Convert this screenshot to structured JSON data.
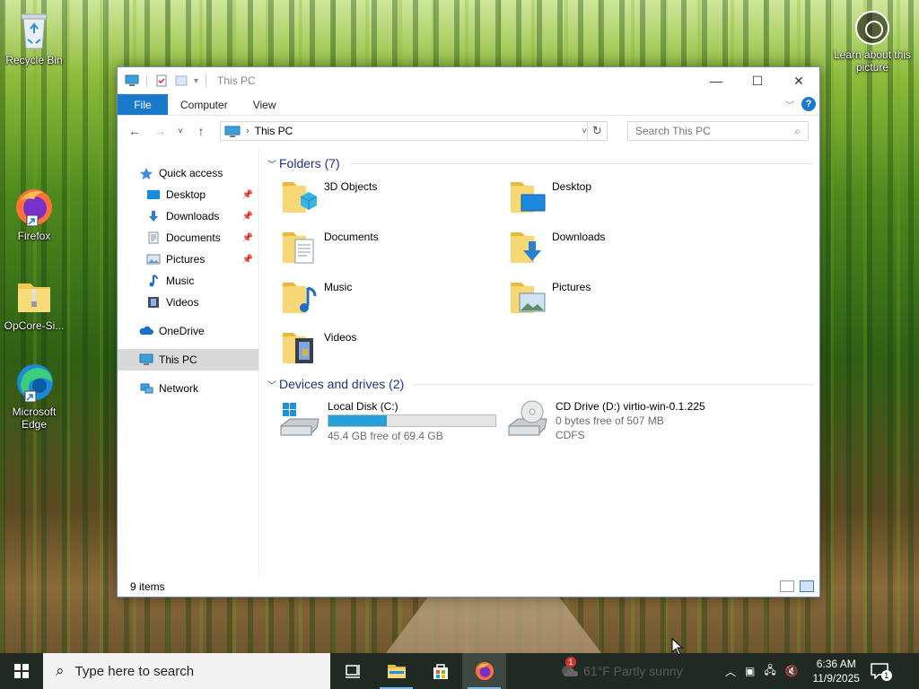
{
  "desktop": {
    "icons": [
      {
        "label": "Recycle Bin"
      },
      {
        "label": "Firefox"
      },
      {
        "label": "OpCore-Si..."
      },
      {
        "label": "Microsoft Edge"
      }
    ],
    "learn_label": "Learn about this picture"
  },
  "window": {
    "title": "This PC",
    "tabs": {
      "file": "File",
      "computer": "Computer",
      "view": "View"
    },
    "help_label": "?",
    "address": {
      "crumb": "This PC"
    },
    "search": {
      "placeholder": "Search This PC"
    },
    "nav": {
      "quick_access": "Quick access",
      "desktop": "Desktop",
      "downloads": "Downloads",
      "documents": "Documents",
      "pictures": "Pictures",
      "music": "Music",
      "videos": "Videos",
      "onedrive": "OneDrive",
      "this_pc": "This PC",
      "network": "Network"
    },
    "folders_header": "Folders (7)",
    "folders": [
      {
        "name": "3D Objects"
      },
      {
        "name": "Desktop"
      },
      {
        "name": "Documents"
      },
      {
        "name": "Downloads"
      },
      {
        "name": "Music"
      },
      {
        "name": "Pictures"
      },
      {
        "name": "Videos"
      }
    ],
    "drives_header": "Devices and drives (2)",
    "drives": [
      {
        "name": "Local Disk (C:)",
        "free": "45.4 GB free of 69.4 GB",
        "used_fraction": 0.35
      },
      {
        "name": "CD Drive (D:) virtio-win-0.1.225",
        "free": "0 bytes free of 507 MB",
        "fs": "CDFS"
      }
    ],
    "status": "9 items"
  },
  "taskbar": {
    "search_placeholder": "Type here to search",
    "weather": "61°F  Partly sunny",
    "weather_badge": "1",
    "time": "6:36 AM",
    "date": "11/9/2025",
    "notification_count": "1"
  },
  "colors": {
    "accent": "#1979ca",
    "header_text": "#1e3287",
    "drive_bar": "#26a0da",
    "folder_yellow": "#f4c94f"
  }
}
